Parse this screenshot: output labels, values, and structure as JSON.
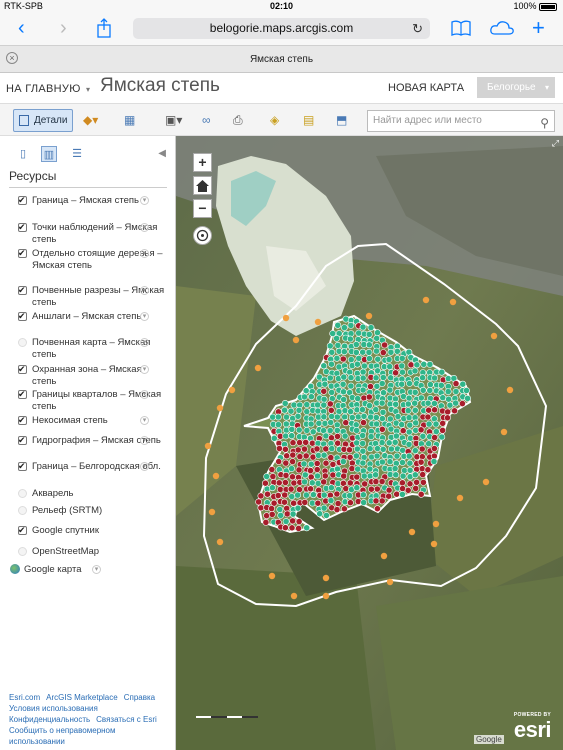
{
  "status": {
    "carrier": "RTK-SPB",
    "time": "02:10",
    "battery": "100%"
  },
  "safari": {
    "url": "belogorie.maps.arcgis.com",
    "tab_title": "Ямская степь"
  },
  "header": {
    "home": "НА ГЛАВНУЮ",
    "title": "Ямская степь",
    "new_map": "НОВАЯ КАРТА",
    "region": "Белогорье"
  },
  "toolbar": {
    "details": "Детали",
    "search_placeholder": "Найти адрес или место"
  },
  "sidebar": {
    "heading": "Ресурсы",
    "layers": [
      {
        "label": "Граница – Ямская степь",
        "checked": true
      },
      {
        "label": "Точки наблюдений – Ямская степь",
        "checked": true
      },
      {
        "label": "Отдельно стоящие деревья – Ямская степь",
        "checked": true
      },
      {
        "label": "Почвенные разрезы – Ямская степь",
        "checked": true
      },
      {
        "label": "Аншлаги – Ямская степь",
        "checked": true
      },
      {
        "label": "Почвенная карта – Ямская степь",
        "checked": false
      },
      {
        "label": "Охранная зона – Ямская степь",
        "checked": true
      },
      {
        "label": "Границы кварталов – Ямская степь",
        "checked": true
      },
      {
        "label": "Некосимая степь",
        "checked": true
      },
      {
        "label": "Гидрография – Ямская степь",
        "checked": true
      },
      {
        "label": "Граница – Белгородская обл.",
        "checked": true
      },
      {
        "label": "Акварель",
        "checked": false
      },
      {
        "label": "Рельеф (SRTM)",
        "checked": false
      },
      {
        "label": "Google спутник",
        "checked": true
      },
      {
        "label": "OpenStreetMap",
        "checked": false
      }
    ],
    "basemap": "Google карта",
    "footer": {
      "l1": "Esri.com",
      "l2": "ArcGIS Marketplace",
      "l3": "Справка",
      "l4": "Условия использования",
      "l5": "Конфиденциальность",
      "l6": "Связаться с Esri",
      "l7": "Сообщить о неправомерном использовании"
    }
  },
  "map": {
    "attribution": "Google",
    "logo_small": "POWERED BY",
    "logo": "esri",
    "zoom_in": "+",
    "zoom_out": "−",
    "colors": {
      "observation_point": "#f0a040",
      "green_point": "#2fb58a",
      "red_point": "#a81d2b",
      "boundary": "#ffffff"
    }
  }
}
